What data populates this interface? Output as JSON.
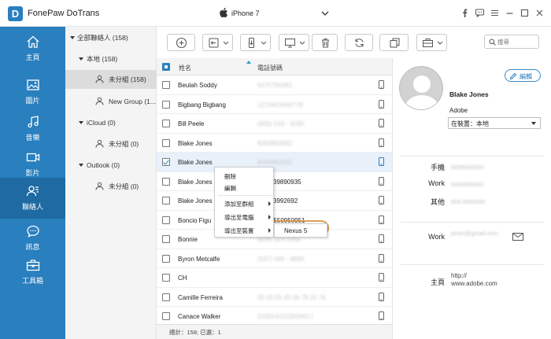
{
  "app": {
    "logo_letter": "D",
    "title": "FonePaw DoTrans",
    "device": "iPhone 7"
  },
  "nav": [
    {
      "label": "主頁",
      "icon": "home-icon"
    },
    {
      "label": "圖片",
      "icon": "photo-icon"
    },
    {
      "label": "音樂",
      "icon": "music-icon"
    },
    {
      "label": "影片",
      "icon": "video-icon"
    },
    {
      "label": "聯絡人",
      "icon": "contacts-icon",
      "active": true
    },
    {
      "label": "訊息",
      "icon": "message-icon"
    },
    {
      "label": "工具箱",
      "icon": "toolbox-icon"
    }
  ],
  "groups": {
    "all": "全部聯絡人 (158)",
    "local": "本地 (158)",
    "local_ungrouped": "未分組 (158)",
    "new_group": "New Group (1...",
    "icloud": "iCloud (0)",
    "icloud_ungrouped": "未分組 (0)",
    "outlook": "Outlook (0)",
    "outlook_ungrouped": "未分組 (0)"
  },
  "search": {
    "placeholder": "搜尋"
  },
  "list": {
    "col_name": "姓名",
    "col_phone": "電話號碼",
    "rows": [
      {
        "name": "Beulah Soddy",
        "phone": "5075790361"
      },
      {
        "name": "Bigbang Bigbang",
        "phone": "12134534567­78"
      },
      {
        "name": "Bill Peele",
        "phone": "(800) 510 - 9285"
      },
      {
        "name": "Blake Jones",
        "phone": "6058992692"
      },
      {
        "name": "Blake Jones",
        "phone": "6058992692"
      },
      {
        "name": "Blake Jones",
        "phone": "39890935"
      },
      {
        "name": "Blake Jones",
        "phone": "3992692"
      },
      {
        "name": "Boncio Figu",
        "phone": "0550950951"
      },
      {
        "name": "Bonnie",
        "phone": "(828) 323-3356"
      },
      {
        "name": "Byron Metcalfe",
        "phone": "(937) 586 - 9899"
      },
      {
        "name": "CH",
        "phone": ""
      },
      {
        "name": "Camille Ferreira",
        "phone": "05 03 05 45 06 78 15 76"
      },
      {
        "name": "Canace Walker",
        "phone": "0190141523008617"
      }
    ]
  },
  "footer": "總計：158; 已選：1",
  "context_menu": {
    "delete": "刪除",
    "edit": "編輯",
    "add_to_group": "添加至群組",
    "export_to_pc": "導出至電腦",
    "export_to_device": "導出至裝置",
    "submenu_device": "Nexus 5"
  },
  "details": {
    "edit_label": "編輯",
    "name": "Blake Jones",
    "company": "Adobe",
    "location": "在裝置：本地",
    "fields": [
      {
        "label": "手機",
        "value": "6058992692"
      },
      {
        "label": "Work",
        "value": "5408892692"
      },
      {
        "label": "其他",
        "value": "605-8992692"
      },
      {
        "label": "Work",
        "value": "jones@gmail.com"
      },
      {
        "label": "主頁",
        "value": "http://\nwww.adobe.com"
      }
    ]
  },
  "colors": {
    "nav_bg": "#2a7fbe",
    "nav_active": "#1f6aa2",
    "highlight_oval": "#d9a055"
  }
}
